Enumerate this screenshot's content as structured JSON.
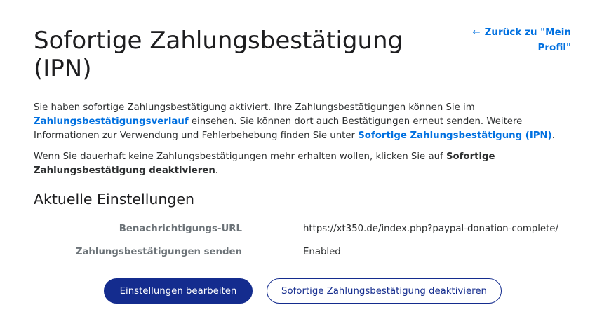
{
  "header": {
    "title": "Sofortige Zahlungsbestätigung (IPN)",
    "back_link": {
      "arrow": "←",
      "label": "Zurück zu \"Mein Profil\""
    }
  },
  "intro": {
    "part1": "Sie haben sofortige Zahlungsbestätigung aktiviert. Ihre Zahlungsbestätigungen können Sie im ",
    "history_link": "Zahlungsbestätigungsverlauf",
    "part2": " einsehen. Sie können dort auch Bestätigungen erneut senden. Weitere Informationen zur Verwendung und Fehlerbehebung finden Sie unter ",
    "ipn_link": "Sofortige Zahlungsbestätigung (IPN)",
    "part3": "."
  },
  "deactivate_info": {
    "text": "Wenn Sie dauerhaft keine Zahlungsbestätigungen mehr erhalten wollen, klicken Sie auf ",
    "bold": "Sofortige Zahlungsbestätigung deaktivieren",
    "end": "."
  },
  "current_settings": {
    "title": "Aktuelle Einstellungen",
    "rows": [
      {
        "label": "Benachrichtigungs-URL",
        "value": "https://xt350.de/index.php?paypal-donation-complete/"
      },
      {
        "label": "Zahlungsbestätigungen senden",
        "value": "Enabled"
      }
    ]
  },
  "buttons": {
    "edit": "Einstellungen bearbeiten",
    "deactivate": "Sofortige Zahlungsbestätigung deaktivieren"
  },
  "colors": {
    "link": "#0070e0",
    "primary_button": "#142c8e",
    "label_gray": "#6c7378"
  }
}
